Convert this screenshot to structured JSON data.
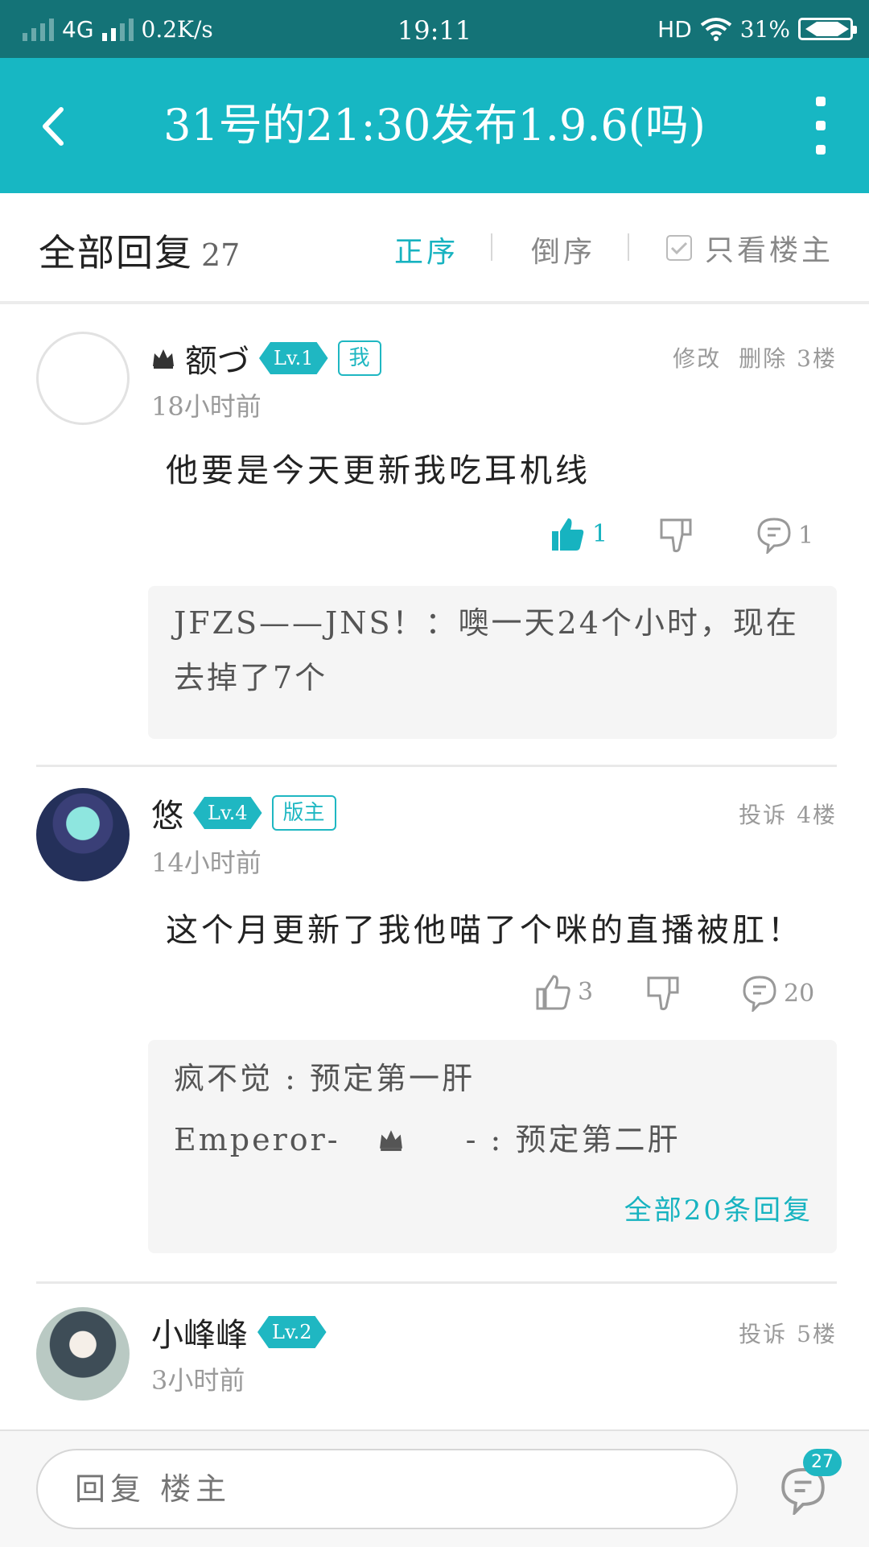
{
  "status_bar": {
    "network": "4G",
    "speed": "0.2K/s",
    "time": "19:11",
    "hd": "HD",
    "battery": "31%",
    "battery_level": 0.31
  },
  "header": {
    "title": "31号的21:30发布1.9.6(吗)"
  },
  "sort_bar": {
    "all_label": "全部回复",
    "count": "27",
    "asc": "正序",
    "desc": "倒序",
    "only_op": "只看楼主"
  },
  "posts": [
    {
      "username": "额づ",
      "level": "Lv.1",
      "tag": "我",
      "time": "18小时前",
      "actions": [
        "修改",
        "删除"
      ],
      "floor": "3楼",
      "content": "他要是今天更新我吃耳机线",
      "likes": "1",
      "comments": "1",
      "quotes": [
        "JFZS——JNS！：噢一天24个小时，现在去掉了7个"
      ]
    },
    {
      "username": "悠",
      "level": "Lv.4",
      "tag": "版主",
      "time": "14小时前",
      "actions": [
        "投诉"
      ],
      "floor": "4楼",
      "content": "这个月更新了我他喵了个咪的直播被肛！",
      "likes": "3",
      "comments": "20",
      "quotes": [
        "疯不觉 : 预定第一肝",
        "Emperor-",
        "- : 预定第二肝"
      ],
      "more_replies": "全部20条回复"
    },
    {
      "username": "小峰峰",
      "level": "Lv.2",
      "time": "3小时前",
      "actions": [
        "投诉"
      ],
      "floor": "5楼"
    }
  ],
  "bottom_bar": {
    "placeholder": "回复 楼主",
    "badge": "27"
  },
  "colors": {
    "accent": "#17b7c3",
    "status_bar": "#147377"
  }
}
